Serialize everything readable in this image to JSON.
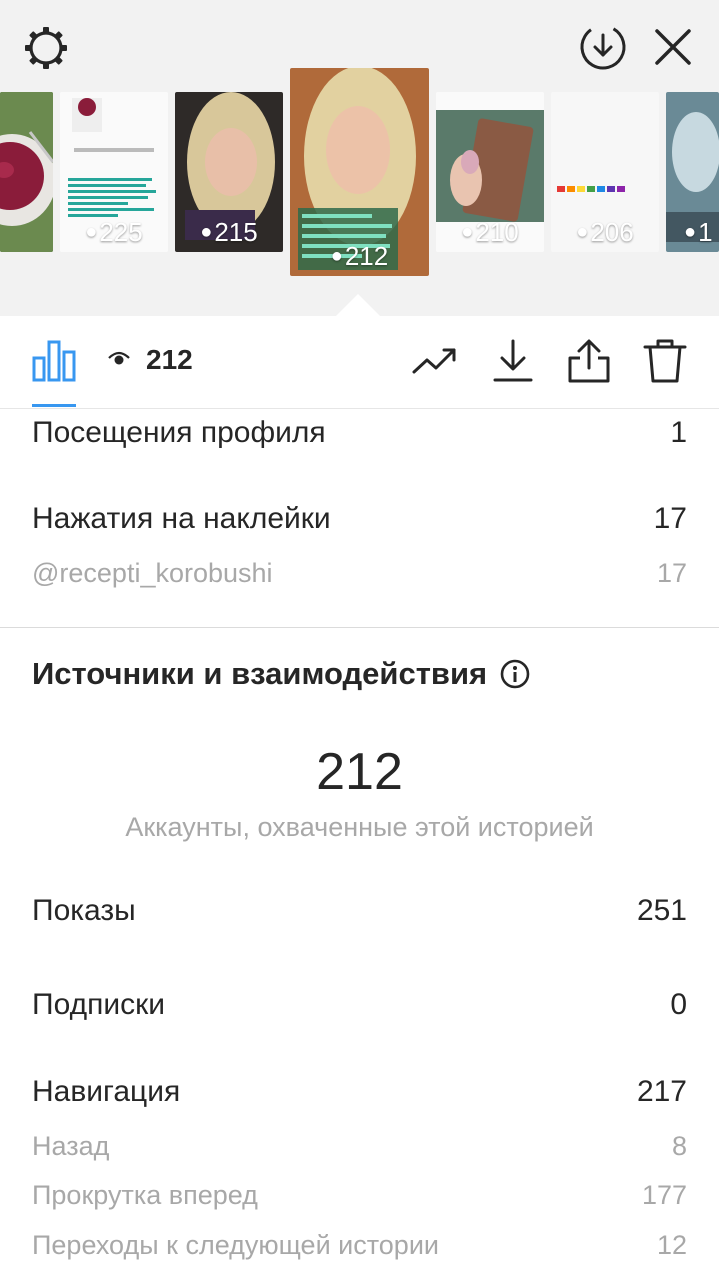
{
  "header": {
    "settings_icon": "gear-icon",
    "download_icon": "download-circle-icon",
    "close_icon": "close-icon"
  },
  "stories": [
    {
      "views": null
    },
    {
      "views": "225"
    },
    {
      "views": "215"
    },
    {
      "views": "212",
      "selected": true
    },
    {
      "views": "210"
    },
    {
      "views": "206"
    },
    {
      "views": "1"
    }
  ],
  "toolbar": {
    "views_count": "212",
    "icons": [
      "bar-chart-icon",
      "eye-icon",
      "trending-icon",
      "download-icon",
      "share-icon",
      "trash-icon"
    ]
  },
  "stats_top": {
    "profile_visits": {
      "label": "Посещения профиля",
      "value": "1"
    },
    "sticker_taps": {
      "label": "Нажатия на наклейки",
      "value": "17"
    },
    "sticker_account": {
      "label": "@recepti_korobushi",
      "value": "17"
    }
  },
  "sources": {
    "title": "Источники и взаимодействия",
    "reach_value": "212",
    "reach_caption": "Аккаунты, охваченные этой историей",
    "impressions": {
      "label": "Показы",
      "value": "251"
    },
    "follows": {
      "label": "Подписки",
      "value": "0"
    },
    "navigation": {
      "label": "Навигация",
      "value": "217"
    },
    "back": {
      "label": "Назад",
      "value": "8"
    },
    "forward": {
      "label": "Прокрутка вперед",
      "value": "177"
    },
    "next_story": {
      "label": "Переходы к следующей истории",
      "value": "12"
    }
  },
  "colors": {
    "accent": "#3897f0",
    "text": "#262626",
    "muted": "#a8a8a8"
  }
}
